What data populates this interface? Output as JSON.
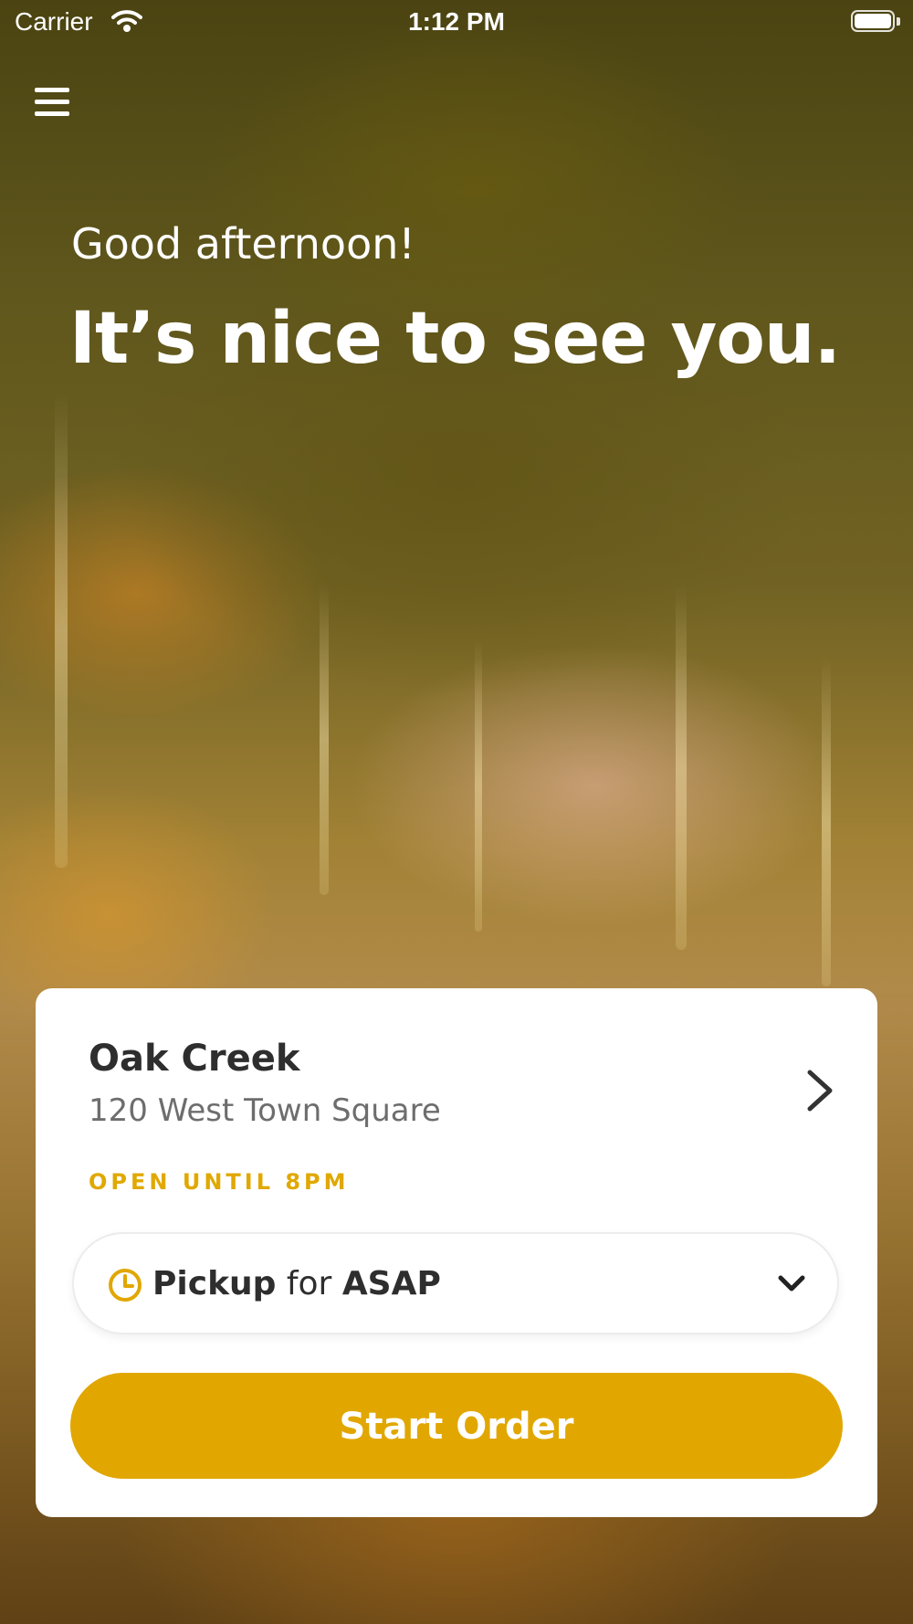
{
  "status_bar": {
    "carrier": "Carrier",
    "time": "1:12 PM"
  },
  "hero": {
    "greeting": "Good afternoon!",
    "headline": "It’s nice to see you."
  },
  "location_card": {
    "store_name": "Oak Creek",
    "address": "120 West Town Square",
    "hours": "OPEN UNTIL 8PM",
    "order_mode": {
      "method": "Pickup",
      "connector": "for",
      "time": "ASAP"
    },
    "start_order_label": "Start Order"
  },
  "colors": {
    "accent": "#e1a700",
    "hours_text": "#e0a800",
    "card_bg": "#ffffff",
    "text_dark": "#2e2e2e",
    "text_muted": "#6d6d6d"
  },
  "icons": {
    "menu": "hamburger-menu-icon",
    "wifi": "wifi-icon",
    "battery": "battery-icon",
    "store_chevron": "chevron-right-icon",
    "clock": "clock-icon",
    "dropdown": "chevron-down-icon"
  }
}
